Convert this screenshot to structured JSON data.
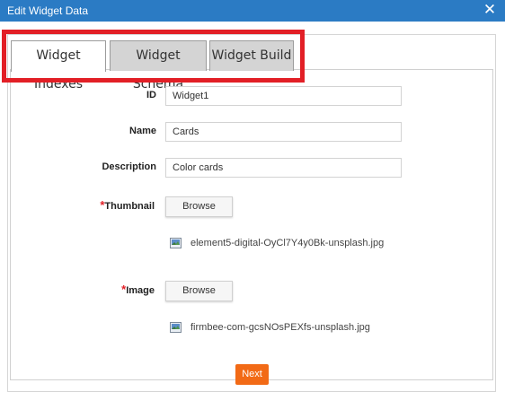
{
  "window": {
    "title": "Edit Widget Data",
    "close_icon": "close-icon",
    "close_glyph": "✕"
  },
  "tabs": [
    {
      "label": "Widget Indexes",
      "active": true
    },
    {
      "label": "Widget Schema",
      "active": false
    },
    {
      "label": "Widget Build",
      "active": false
    }
  ],
  "highlight_color": "#e21f26",
  "form": {
    "id": {
      "label": "ID",
      "value": "Widget1"
    },
    "name": {
      "label": "Name",
      "value": "Cards"
    },
    "description": {
      "label": "Description",
      "value": "Color cards"
    },
    "thumbnail": {
      "required_mark": "*",
      "label": "Thumbnail",
      "browse_label": "Browse",
      "file_icon": "image-file-icon",
      "file_name": "element5-digital-OyCl7Y4y0Bk-unsplash.jpg"
    },
    "image": {
      "required_mark": "*",
      "label": "Image",
      "browse_label": "Browse",
      "file_icon": "image-file-icon",
      "file_name": "firmbee-com-gcsNOsPEXfs-unsplash.jpg"
    }
  },
  "next_label": "Next",
  "colors": {
    "titlebar": "#2b7bc4",
    "next_button": "#f26a16",
    "required": "#e21f26"
  }
}
